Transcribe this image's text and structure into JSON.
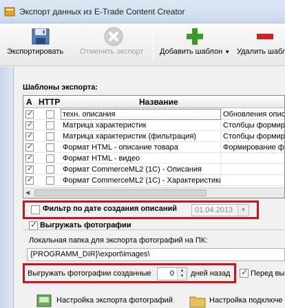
{
  "window": {
    "title": "Экспорт данных из E-Trade Content Creator"
  },
  "toolbar": {
    "export_label": "Экспортировать",
    "cancel_label": "Отменить экспорт",
    "add_template_label": "Добавить шаблон",
    "delete_template_label": "Удалить шабл"
  },
  "templates": {
    "section_title": "Шаблоны экспорта:",
    "columns": [
      "A",
      "HTTP",
      "Название"
    ],
    "rows": [
      {
        "active": true,
        "http": false,
        "name": "техн. описания",
        "desc": "Обновления описа"
      },
      {
        "active": true,
        "http": false,
        "name": "Матрица характеристик",
        "desc": "Столбцы формиру"
      },
      {
        "active": true,
        "http": false,
        "name": "Матрица характеристик (фильтрация)",
        "desc": "Столбцы формиру"
      },
      {
        "active": true,
        "http": false,
        "name": "Формат HTML - описание товара",
        "desc": "Формирование ф"
      },
      {
        "active": true,
        "http": false,
        "name": "Формат HTML - видео",
        "desc": ""
      },
      {
        "active": true,
        "http": false,
        "name": "Формат CommerceML2 (1С) - Описания",
        "desc": ""
      },
      {
        "active": true,
        "http": false,
        "name": "Формат CommerceML2 (1С) - Характеристики",
        "desc": ""
      }
    ]
  },
  "filter": {
    "label": "Фильтр по дате создания описаний",
    "checked": false,
    "date_value": "01.04.2013"
  },
  "photos": {
    "label": "Выгружать фотографии",
    "checked": true,
    "local_folder_label": "Локальная папка для экспорта фотографий на ПК:",
    "path_value": "{PROGRAMM_DIR}\\export\\images\\",
    "created_label": "Выгружать фотографии созданные",
    "days_value": "0",
    "days_suffix": "дней назад",
    "before_label": "Перед выг",
    "before_checked": true
  },
  "bottom": {
    "photo_settings_label": "Настройка экспорта фотографий",
    "connection_settings_label": "Настройка подключе"
  },
  "colors": {
    "highlight_box": "#d0101a",
    "add_green": "#3a9b2a",
    "delete_red": "#d42020"
  }
}
